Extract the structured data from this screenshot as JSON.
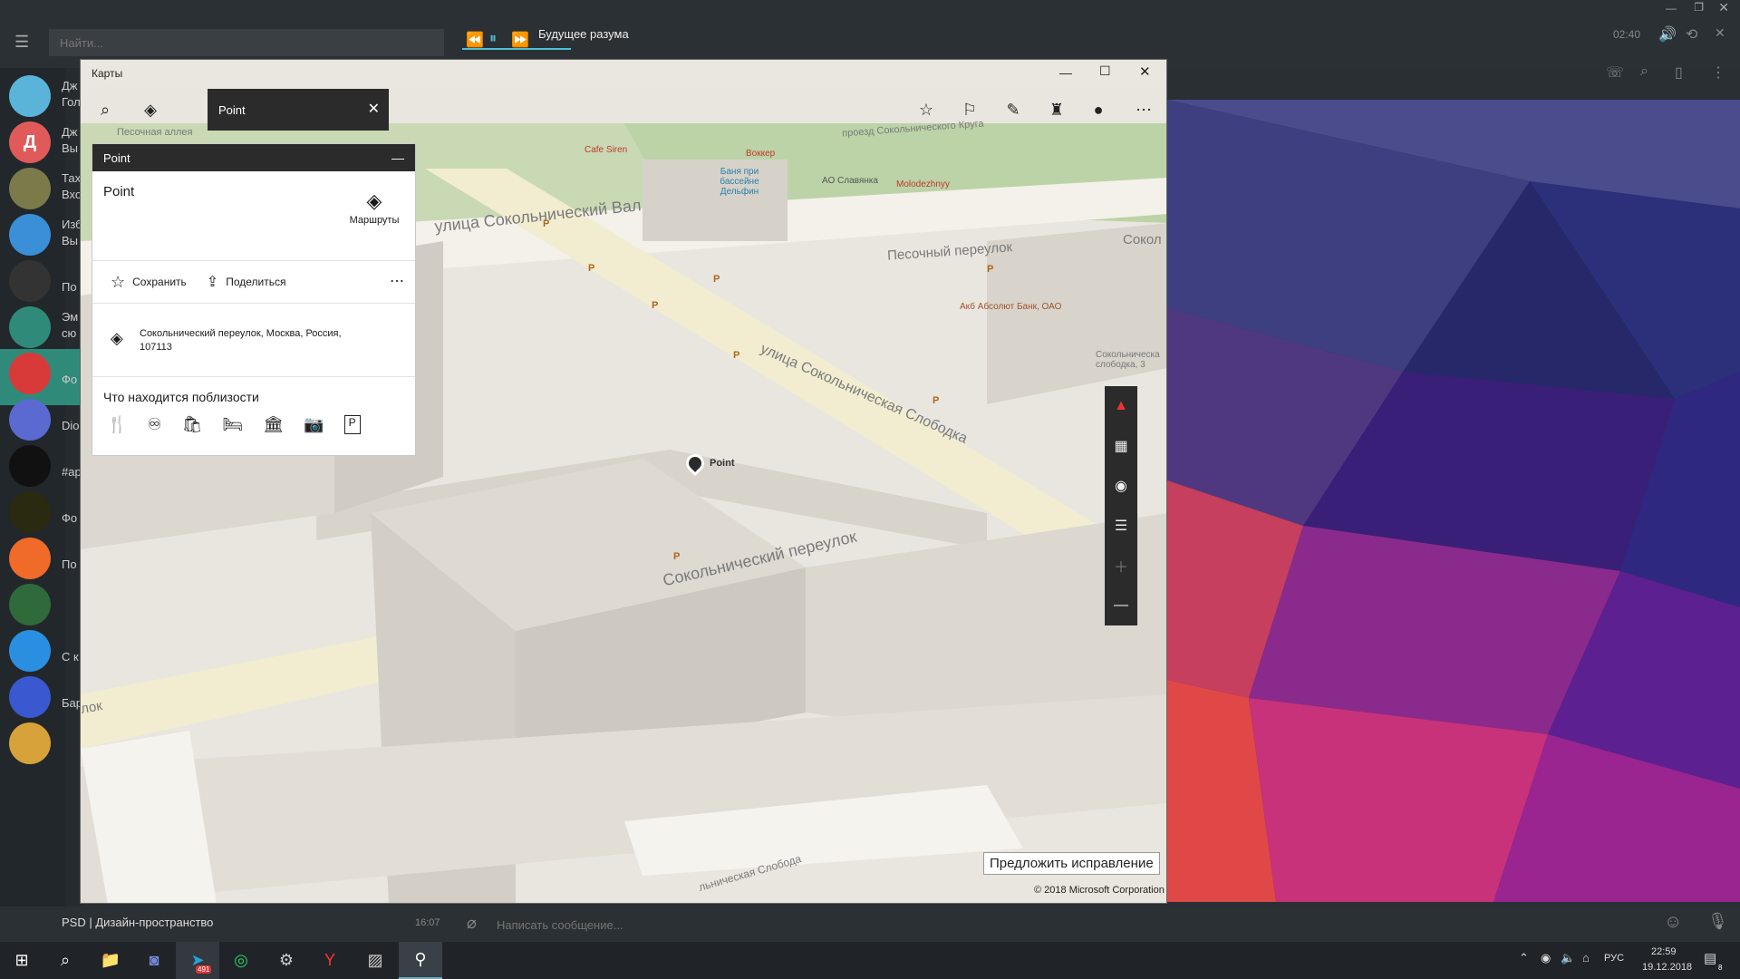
{
  "telegram": {
    "search_placeholder": "Найти...",
    "track_title": "Будущее разума",
    "track_time": "02:40",
    "chat_snippets": [
      {
        "line1": "Дж",
        "line2": "Гол"
      },
      {
        "line1": "Дж",
        "line2": "Вы"
      },
      {
        "line1": "Тах",
        "line2": "Вхо"
      },
      {
        "line1": "Изб",
        "line2": "Вы"
      },
      {
        "line1": "",
        "line2": "По"
      },
      {
        "line1": "Эм",
        "line2": "сю"
      },
      {
        "line1": "",
        "line2": "Фо"
      },
      {
        "line1": "",
        "line2": "Dio"
      },
      {
        "line1": "",
        "line2": "#ар"
      },
      {
        "line1": "",
        "line2": "Фо"
      },
      {
        "line1": "",
        "line2": "По"
      },
      {
        "line1": "",
        "line2": ""
      },
      {
        "line1": "",
        "line2": "С к"
      },
      {
        "line1": "",
        "line2": "Бар"
      },
      {
        "line1": "",
        "line2": ""
      }
    ],
    "avatar_letters": [
      "",
      "Д",
      "",
      "",
      "",
      "",
      "",
      "",
      "",
      "",
      "",
      "",
      "",
      "",
      ""
    ],
    "current_chat": "PSD | Дизайн-пространство",
    "current_chat_time": "16:07",
    "message_placeholder": "Написать сообщение..."
  },
  "maps": {
    "title": "Карты",
    "search_value": "Point",
    "panel": {
      "header": "Point",
      "name": "Point",
      "routes_label": "Маршруты",
      "save_label": "Сохранить",
      "share_label": "Поделиться",
      "address": "Сокольнический переулок, Москва, Россия, 107113",
      "nearby_title": "Что находится поблизости"
    },
    "pin_label": "Point",
    "streets": [
      "улица Сокольнический Вал",
      "Песочный переулок",
      "улица Сокольническая Слободка",
      "Сокольнический переулок",
      "Песочная аллея",
      "проезд Сокольнического Круга",
      "Сокол",
      "лок",
      "льническая Слобода"
    ],
    "pois": [
      "Cafe Siren",
      "Воккер",
      "Баня при бассейне Дельфин",
      "АО Славянка",
      "Molodezhnyy",
      "Акб Абсолют Банк, ОАО",
      "Сокольническа слободка, 3"
    ],
    "feedback_button": "Предложить исправление",
    "copyright": "© 2018 Microsoft Corporation"
  },
  "taskbar": {
    "lang": "РУС",
    "time": "22:59",
    "date": "19.12.2018",
    "telegram_badge": "491",
    "notif_count": "8"
  }
}
